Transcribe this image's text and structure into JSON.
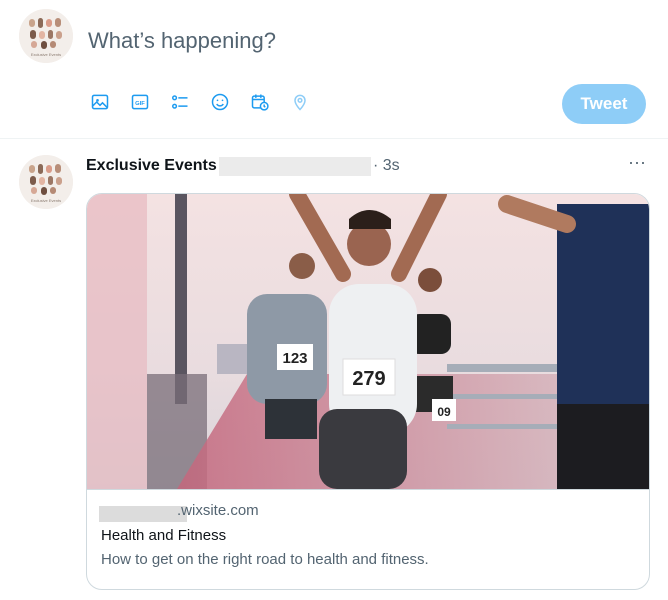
{
  "composer": {
    "placeholder": "What’s happening?",
    "tweet_label": "Tweet",
    "tools": [
      {
        "icon": "image-icon"
      },
      {
        "icon": "gif-icon",
        "label": "GIF"
      },
      {
        "icon": "poll-icon"
      },
      {
        "icon": "emoji-icon"
      },
      {
        "icon": "schedule-icon"
      },
      {
        "icon": "location-icon"
      }
    ],
    "accent_color": "#1d9bf0",
    "button_color": "#8ecdf7"
  },
  "avatar_text": "Exclusive Events",
  "tweet": {
    "author": "Exclusive Events",
    "timestamp": "· 3s",
    "more_label": "···",
    "card": {
      "image_bibs": [
        "123",
        "279",
        "09"
      ],
      "domain": ".wixsite.com",
      "title": "Health and Fitness",
      "description": "How to get on the right road to health and fitness."
    }
  }
}
